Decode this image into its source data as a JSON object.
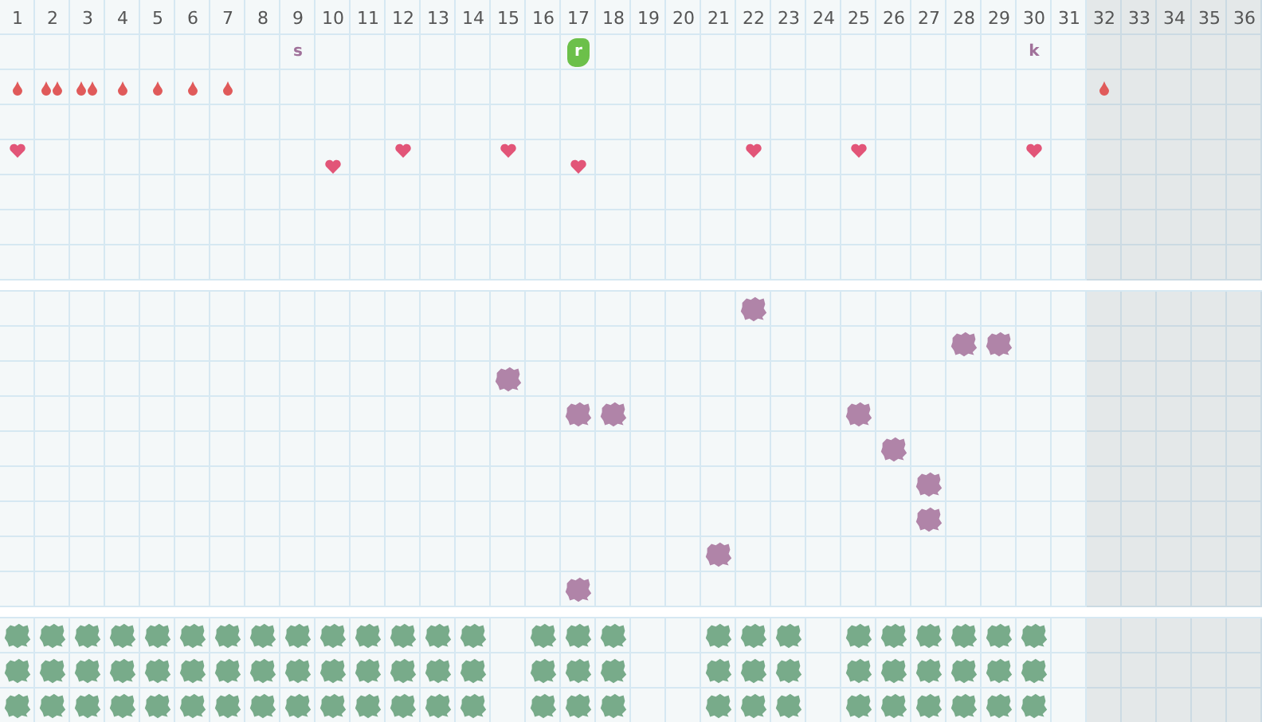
{
  "days": [
    {
      "label": "1",
      "inactive": false
    },
    {
      "label": "2",
      "inactive": false
    },
    {
      "label": "3",
      "inactive": false
    },
    {
      "label": "4",
      "inactive": false
    },
    {
      "label": "5",
      "inactive": false
    },
    {
      "label": "6",
      "inactive": false
    },
    {
      "label": "7",
      "inactive": false
    },
    {
      "label": "8",
      "inactive": false
    },
    {
      "label": "9",
      "inactive": false
    },
    {
      "label": "10",
      "inactive": false
    },
    {
      "label": "11",
      "inactive": false
    },
    {
      "label": "12",
      "inactive": false
    },
    {
      "label": "13",
      "inactive": false
    },
    {
      "label": "14",
      "inactive": false
    },
    {
      "label": "15",
      "inactive": false
    },
    {
      "label": "16",
      "inactive": false
    },
    {
      "label": "17",
      "inactive": false
    },
    {
      "label": "18",
      "inactive": false
    },
    {
      "label": "19",
      "inactive": false
    },
    {
      "label": "20",
      "inactive": false
    },
    {
      "label": "21",
      "inactive": false
    },
    {
      "label": "22",
      "inactive": false
    },
    {
      "label": "23",
      "inactive": false
    },
    {
      "label": "24",
      "inactive": false
    },
    {
      "label": "25",
      "inactive": false
    },
    {
      "label": "26",
      "inactive": false
    },
    {
      "label": "27",
      "inactive": false
    },
    {
      "label": "28",
      "inactive": false
    },
    {
      "label": "29",
      "inactive": false
    },
    {
      "label": "30",
      "inactive": false
    },
    {
      "label": "31",
      "inactive": false
    },
    {
      "label": "32",
      "inactive": true
    },
    {
      "label": "33",
      "inactive": true
    },
    {
      "label": "34",
      "inactive": true
    },
    {
      "label": "35",
      "inactive": true
    },
    {
      "label": "36",
      "inactive": true
    }
  ],
  "sections": [
    {
      "rows": [
        {
          "cells": [
            null,
            null,
            null,
            null,
            null,
            null,
            null,
            null,
            {
              "kind": "letter",
              "text": "s"
            },
            null,
            null,
            null,
            null,
            null,
            null,
            null,
            {
              "kind": "badge",
              "text": "r"
            },
            null,
            null,
            null,
            null,
            null,
            null,
            null,
            null,
            null,
            null,
            null,
            null,
            {
              "kind": "letter",
              "text": "k"
            },
            null,
            null,
            null,
            null,
            null,
            null
          ]
        },
        {
          "cells": [
            {
              "kind": "drop"
            },
            {
              "kind": "drops"
            },
            {
              "kind": "drops"
            },
            {
              "kind": "drop"
            },
            {
              "kind": "drop"
            },
            {
              "kind": "drop"
            },
            {
              "kind": "drop"
            },
            null,
            null,
            null,
            null,
            null,
            null,
            null,
            null,
            null,
            null,
            null,
            null,
            null,
            null,
            null,
            null,
            null,
            null,
            null,
            null,
            null,
            null,
            null,
            null,
            {
              "kind": "drop"
            },
            null,
            null,
            null,
            null
          ]
        },
        {
          "cells": [
            null,
            null,
            null,
            null,
            null,
            null,
            null,
            null,
            null,
            null,
            null,
            null,
            null,
            null,
            null,
            null,
            null,
            null,
            null,
            null,
            null,
            null,
            null,
            null,
            null,
            null,
            null,
            null,
            null,
            null,
            null,
            null,
            null,
            null,
            null,
            null
          ]
        },
        {
          "cells": [
            {
              "kind": "heart"
            },
            null,
            null,
            null,
            null,
            null,
            null,
            null,
            null,
            {
              "kind": "heart-low"
            },
            null,
            {
              "kind": "heart"
            },
            null,
            null,
            {
              "kind": "heart"
            },
            null,
            {
              "kind": "heart-low"
            },
            null,
            null,
            null,
            null,
            {
              "kind": "heart"
            },
            null,
            null,
            {
              "kind": "heart"
            },
            null,
            null,
            null,
            null,
            {
              "kind": "heart"
            },
            null,
            null,
            null,
            null,
            null,
            null
          ]
        },
        {
          "cells": [
            null,
            null,
            null,
            null,
            null,
            null,
            null,
            null,
            null,
            null,
            null,
            null,
            null,
            null,
            null,
            null,
            null,
            null,
            null,
            null,
            null,
            null,
            null,
            null,
            null,
            null,
            null,
            null,
            null,
            null,
            null,
            null,
            null,
            null,
            null,
            null
          ]
        },
        {
          "cells": [
            null,
            null,
            null,
            null,
            null,
            null,
            null,
            null,
            null,
            null,
            null,
            null,
            null,
            null,
            null,
            null,
            null,
            null,
            null,
            null,
            null,
            null,
            null,
            null,
            null,
            null,
            null,
            null,
            null,
            null,
            null,
            null,
            null,
            null,
            null,
            null
          ]
        },
        {
          "cells": [
            null,
            null,
            null,
            null,
            null,
            null,
            null,
            null,
            null,
            null,
            null,
            null,
            null,
            null,
            null,
            null,
            null,
            null,
            null,
            null,
            null,
            null,
            null,
            null,
            null,
            null,
            null,
            null,
            null,
            null,
            null,
            null,
            null,
            null,
            null,
            null
          ]
        }
      ]
    },
    {
      "rows": [
        {
          "cells": [
            null,
            null,
            null,
            null,
            null,
            null,
            null,
            null,
            null,
            null,
            null,
            null,
            null,
            null,
            null,
            null,
            null,
            null,
            null,
            null,
            null,
            {
              "kind": "blob"
            },
            null,
            null,
            null,
            null,
            null,
            null,
            null,
            null,
            null,
            null,
            null,
            null,
            null,
            null
          ]
        },
        {
          "cells": [
            null,
            null,
            null,
            null,
            null,
            null,
            null,
            null,
            null,
            null,
            null,
            null,
            null,
            null,
            null,
            null,
            null,
            null,
            null,
            null,
            null,
            null,
            null,
            null,
            null,
            null,
            null,
            {
              "kind": "blob"
            },
            {
              "kind": "blob"
            },
            null,
            null,
            null,
            null,
            null,
            null,
            null
          ]
        },
        {
          "cells": [
            null,
            null,
            null,
            null,
            null,
            null,
            null,
            null,
            null,
            null,
            null,
            null,
            null,
            null,
            {
              "kind": "blob"
            },
            null,
            null,
            null,
            null,
            null,
            null,
            null,
            null,
            null,
            null,
            null,
            null,
            null,
            null,
            null,
            null,
            null,
            null,
            null,
            null,
            null
          ]
        },
        {
          "cells": [
            null,
            null,
            null,
            null,
            null,
            null,
            null,
            null,
            null,
            null,
            null,
            null,
            null,
            null,
            null,
            null,
            {
              "kind": "blob"
            },
            {
              "kind": "blob"
            },
            null,
            null,
            null,
            null,
            null,
            null,
            {
              "kind": "blob"
            },
            null,
            null,
            null,
            null,
            null,
            null,
            null,
            null,
            null,
            null,
            null
          ]
        },
        {
          "cells": [
            null,
            null,
            null,
            null,
            null,
            null,
            null,
            null,
            null,
            null,
            null,
            null,
            null,
            null,
            null,
            null,
            null,
            null,
            null,
            null,
            null,
            null,
            null,
            null,
            null,
            {
              "kind": "blob"
            },
            null,
            null,
            null,
            null,
            null,
            null,
            null,
            null,
            null,
            null
          ]
        },
        {
          "cells": [
            null,
            null,
            null,
            null,
            null,
            null,
            null,
            null,
            null,
            null,
            null,
            null,
            null,
            null,
            null,
            null,
            null,
            null,
            null,
            null,
            null,
            null,
            null,
            null,
            null,
            null,
            {
              "kind": "blob"
            },
            null,
            null,
            null,
            null,
            null,
            null,
            null,
            null,
            null
          ]
        },
        {
          "cells": [
            null,
            null,
            null,
            null,
            null,
            null,
            null,
            null,
            null,
            null,
            null,
            null,
            null,
            null,
            null,
            null,
            null,
            null,
            null,
            null,
            null,
            null,
            null,
            null,
            null,
            null,
            {
              "kind": "blob"
            },
            null,
            null,
            null,
            null,
            null,
            null,
            null,
            null,
            null
          ]
        },
        {
          "cells": [
            null,
            null,
            null,
            null,
            null,
            null,
            null,
            null,
            null,
            null,
            null,
            null,
            null,
            null,
            null,
            null,
            null,
            null,
            null,
            null,
            {
              "kind": "blob"
            },
            null,
            null,
            null,
            null,
            null,
            null,
            null,
            null,
            null,
            null,
            null,
            null,
            null,
            null,
            null
          ]
        },
        {
          "cells": [
            null,
            null,
            null,
            null,
            null,
            null,
            null,
            null,
            null,
            null,
            null,
            null,
            null,
            null,
            null,
            null,
            {
              "kind": "blob"
            },
            null,
            null,
            null,
            null,
            null,
            null,
            null,
            null,
            null,
            null,
            null,
            null,
            null,
            null,
            null,
            null,
            null,
            null,
            null
          ]
        }
      ]
    },
    {
      "rows": [
        {
          "cells": [
            {
              "kind": "green"
            },
            {
              "kind": "green"
            },
            {
              "kind": "green"
            },
            {
              "kind": "green"
            },
            {
              "kind": "green"
            },
            {
              "kind": "green"
            },
            {
              "kind": "green"
            },
            {
              "kind": "green"
            },
            {
              "kind": "green"
            },
            {
              "kind": "green"
            },
            {
              "kind": "green"
            },
            {
              "kind": "green"
            },
            {
              "kind": "green"
            },
            {
              "kind": "green"
            },
            null,
            {
              "kind": "green"
            },
            {
              "kind": "green"
            },
            {
              "kind": "green"
            },
            null,
            null,
            {
              "kind": "green"
            },
            {
              "kind": "green"
            },
            {
              "kind": "green"
            },
            null,
            {
              "kind": "green"
            },
            {
              "kind": "green"
            },
            {
              "kind": "green"
            },
            {
              "kind": "green"
            },
            {
              "kind": "green"
            },
            {
              "kind": "green"
            },
            null,
            null,
            null,
            null,
            null,
            null
          ]
        },
        {
          "cells": [
            {
              "kind": "green"
            },
            {
              "kind": "green"
            },
            {
              "kind": "green"
            },
            {
              "kind": "green"
            },
            {
              "kind": "green"
            },
            {
              "kind": "green"
            },
            {
              "kind": "green"
            },
            {
              "kind": "green"
            },
            {
              "kind": "green"
            },
            {
              "kind": "green"
            },
            {
              "kind": "green"
            },
            {
              "kind": "green"
            },
            {
              "kind": "green"
            },
            {
              "kind": "green"
            },
            null,
            {
              "kind": "green"
            },
            {
              "kind": "green"
            },
            {
              "kind": "green"
            },
            null,
            null,
            {
              "kind": "green"
            },
            {
              "kind": "green"
            },
            {
              "kind": "green"
            },
            null,
            {
              "kind": "green"
            },
            {
              "kind": "green"
            },
            {
              "kind": "green"
            },
            {
              "kind": "green"
            },
            {
              "kind": "green"
            },
            {
              "kind": "green"
            },
            null,
            null,
            null,
            null,
            null,
            null
          ]
        },
        {
          "cells": [
            {
              "kind": "green"
            },
            {
              "kind": "green"
            },
            {
              "kind": "green"
            },
            {
              "kind": "green"
            },
            {
              "kind": "green"
            },
            {
              "kind": "green"
            },
            {
              "kind": "green"
            },
            {
              "kind": "green"
            },
            {
              "kind": "green"
            },
            {
              "kind": "green"
            },
            {
              "kind": "green"
            },
            {
              "kind": "green"
            },
            {
              "kind": "green"
            },
            {
              "kind": "green"
            },
            null,
            {
              "kind": "green"
            },
            {
              "kind": "green"
            },
            {
              "kind": "green"
            },
            null,
            null,
            {
              "kind": "green"
            },
            {
              "kind": "green"
            },
            {
              "kind": "green"
            },
            null,
            {
              "kind": "green"
            },
            {
              "kind": "green"
            },
            {
              "kind": "green"
            },
            {
              "kind": "green"
            },
            {
              "kind": "green"
            },
            {
              "kind": "green"
            },
            null,
            null,
            null,
            null,
            null,
            null
          ]
        }
      ]
    }
  ]
}
